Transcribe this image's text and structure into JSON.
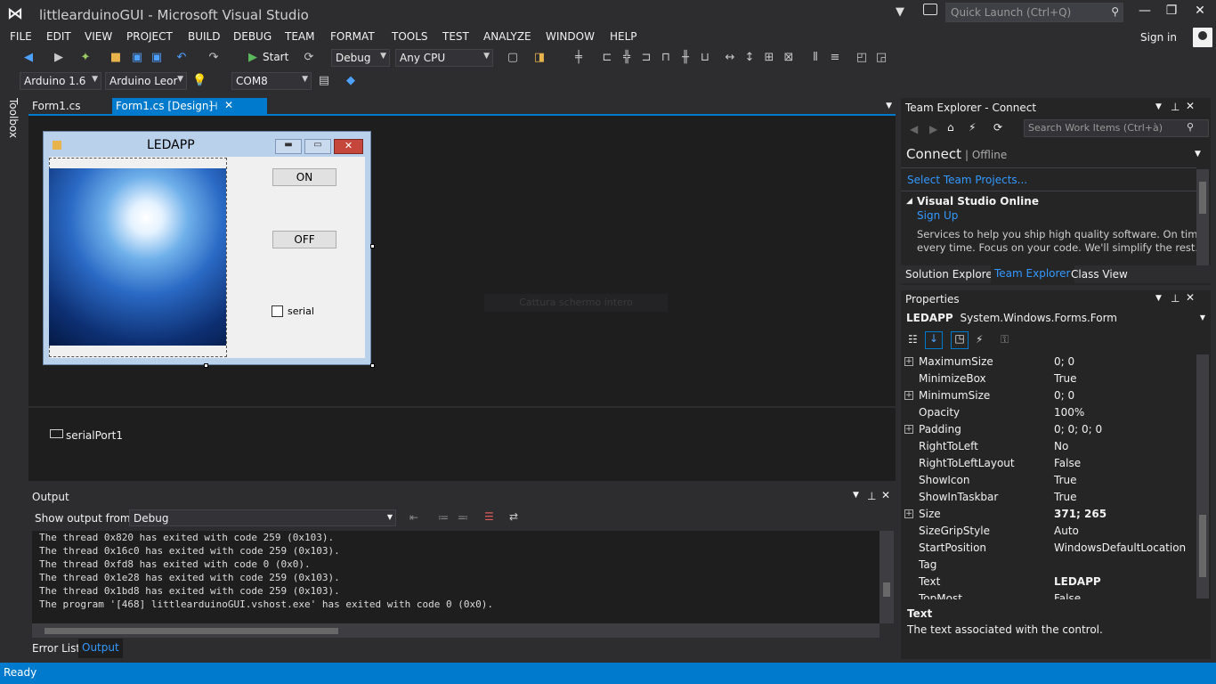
{
  "window": {
    "title": "littlearduinoGUI - Microsoft Visual Studio",
    "quick_launch": "Quick Launch (Ctrl+Q)",
    "sign_in": "Sign in"
  },
  "menu": [
    "FILE",
    "EDIT",
    "VIEW",
    "PROJECT",
    "BUILD",
    "DEBUG",
    "TEAM",
    "FORMAT",
    "TOOLS",
    "TEST",
    "ANALYZE",
    "WINDOW",
    "HELP"
  ],
  "toolbar": {
    "start": "Start",
    "config": "Debug",
    "platform": "Any CPU",
    "board": "Arduino 1.6",
    "board_model": "Arduino Leor",
    "port": "COM8"
  },
  "toolbox": "Toolbox",
  "tabs": [
    {
      "label": "Form1.cs"
    },
    {
      "label": "Form1.cs [Design]"
    }
  ],
  "designer": {
    "form_title": "LEDAPP",
    "btn_on": "ON",
    "btn_off": "OFF",
    "checkbox": "serial",
    "tray_item": "serialPort1",
    "ghost": "Cattura schermo intero"
  },
  "output": {
    "title": "Output",
    "show_from": "Show output from:",
    "source": "Debug",
    "lines": [
      "The thread 0x820 has exited with code 259 (0x103).",
      "The thread 0x16c0 has exited with code 259 (0x103).",
      "The thread 0xfd8 has exited with code 0 (0x0).",
      "The thread 0x1e28 has exited with code 259 (0x103).",
      "The thread 0x1bd8 has exited with code 259 (0x103).",
      "The program '[468] littlearduinoGUI.vshost.exe' has exited with code 0 (0x0)."
    ]
  },
  "bottom_tabs": [
    "Error List",
    "Output"
  ],
  "status": "Ready",
  "team": {
    "title": "Team Explorer - Connect",
    "search": "Search Work Items (Ctrl+à)",
    "connect": "Connect",
    "offline": "Offline",
    "select_projects": "Select Team Projects...",
    "vso": "Visual Studio Online",
    "signup": "Sign Up",
    "desc1": "Services to help you ship high quality software. On time,",
    "desc2": "every time. Focus on your code. We'll simplify the rest.",
    "tabs": [
      "Solution Explorer",
      "Team Explorer",
      "Class View"
    ]
  },
  "properties": {
    "title": "Properties",
    "object": "LEDAPP",
    "type": "System.Windows.Forms.Form",
    "rows": [
      {
        "name": "MaximumSize",
        "value": "0; 0",
        "exp": "+"
      },
      {
        "name": "MinimizeBox",
        "value": "True",
        "exp": ""
      },
      {
        "name": "MinimumSize",
        "value": "0; 0",
        "exp": "+"
      },
      {
        "name": "Opacity",
        "value": "100%",
        "exp": ""
      },
      {
        "name": "Padding",
        "value": "0; 0; 0; 0",
        "exp": "+"
      },
      {
        "name": "RightToLeft",
        "value": "No",
        "exp": ""
      },
      {
        "name": "RightToLeftLayout",
        "value": "False",
        "exp": ""
      },
      {
        "name": "ShowIcon",
        "value": "True",
        "exp": ""
      },
      {
        "name": "ShowInTaskbar",
        "value": "True",
        "exp": ""
      },
      {
        "name": "Size",
        "value": "371; 265",
        "exp": "+"
      },
      {
        "name": "SizeGripStyle",
        "value": "Auto",
        "exp": ""
      },
      {
        "name": "StartPosition",
        "value": "WindowsDefaultLocation",
        "exp": ""
      },
      {
        "name": "Tag",
        "value": "",
        "exp": ""
      },
      {
        "name": "Text",
        "value": "LEDAPP",
        "exp": ""
      },
      {
        "name": "TopMost",
        "value": "False",
        "exp": ""
      }
    ],
    "desc_title": "Text",
    "desc": "The text associated with the control."
  }
}
